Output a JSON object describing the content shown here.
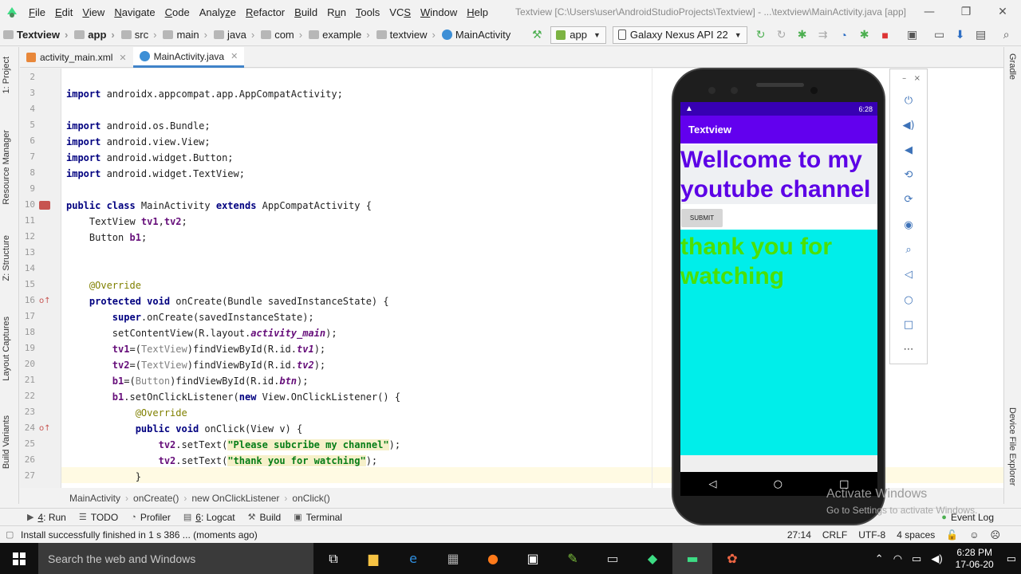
{
  "menu": {
    "items": [
      {
        "pre": "",
        "u": "F",
        "post": "ile"
      },
      {
        "pre": "",
        "u": "E",
        "post": "dit"
      },
      {
        "pre": "",
        "u": "V",
        "post": "iew"
      },
      {
        "pre": "",
        "u": "N",
        "post": "avigate"
      },
      {
        "pre": "",
        "u": "C",
        "post": "ode"
      },
      {
        "pre": "Analy",
        "u": "z",
        "post": "e"
      },
      {
        "pre": "",
        "u": "R",
        "post": "efactor"
      },
      {
        "pre": "",
        "u": "B",
        "post": "uild"
      },
      {
        "pre": "R",
        "u": "u",
        "post": "n"
      },
      {
        "pre": "",
        "u": "T",
        "post": "ools"
      },
      {
        "pre": "VC",
        "u": "S",
        "post": ""
      },
      {
        "pre": "",
        "u": "W",
        "post": "indow"
      },
      {
        "pre": "",
        "u": "H",
        "post": "elp"
      }
    ],
    "window_title": "Textview [C:\\Users\\user\\AndroidStudioProjects\\Textview] - ...\\textview\\MainActivity.java [app]"
  },
  "nav": {
    "crumbs": [
      "Textview",
      "app",
      "src",
      "main",
      "java",
      "com",
      "example",
      "textview",
      "MainActivity"
    ],
    "run_config": "app",
    "device": "Galaxy Nexus API 22"
  },
  "left_strip": [
    "1: Project",
    "Resource Manager",
    "Z: Structure",
    "Layout Captures",
    "Build Variants"
  ],
  "right_strip": [
    "Gradle",
    "Device File Explorer"
  ],
  "tabs": [
    {
      "label": "activity_main.xml",
      "icon": "xml-file-icon"
    },
    {
      "label": "MainActivity.java",
      "icon": "java-class-icon"
    }
  ],
  "code": {
    "line_numbers": [
      "2",
      "3",
      "4",
      "5",
      "6",
      "7",
      "8",
      "9",
      "10",
      "11",
      "12",
      "13",
      "14",
      "15",
      "16",
      "17",
      "18",
      "19",
      "20",
      "21",
      "22",
      "23",
      "24",
      "25",
      "26",
      "27"
    ],
    "l3_kw": "import",
    "l3_rest": " androidx.appcompat.app.AppCompatActivity;",
    "l5_kw": "import",
    "l5_rest": " android.os.Bundle;",
    "l6_kw": "import",
    "l6_rest": " android.view.View;",
    "l7_kw": "import",
    "l7_rest": " android.widget.Button;",
    "l8_kw": "import",
    "l8_rest": " android.widget.TextView;",
    "l10_kw1": "public class",
    "l10_mid": " MainActivity ",
    "l10_kw2": "extends",
    "l10_rest": " AppCompatActivity {",
    "l11_a": "    TextView ",
    "l11_b": "tv1",
    "l11_c": ",",
    "l11_d": "tv2",
    "l11_e": ";",
    "l12_a": "    Button ",
    "l12_b": "b1",
    "l12_c": ";",
    "l15": "    @Override",
    "l16_a": "    ",
    "l16_kw": "protected void",
    "l16_rest": " onCreate(Bundle savedInstanceState) {",
    "l17_a": "        ",
    "l17_kw": "super",
    "l17_rest": ".onCreate(savedInstanceState);",
    "l18_a": "        setContentView(R.layout.",
    "l18_it": "activity_main",
    "l18_rest": ");",
    "l19_a": "        ",
    "l19_f": "tv1",
    "l19_b": "=(",
    "l19_cast": "TextView",
    "l19_c": ")findViewById(R.id.",
    "l19_it": "tv1",
    "l19_d": ");",
    "l20_a": "        ",
    "l20_f": "tv2",
    "l20_b": "=(",
    "l20_cast": "TextView",
    "l20_c": ")findViewById(R.id.",
    "l20_it": "tv2",
    "l20_d": ");",
    "l21_a": "        ",
    "l21_f": "b1",
    "l21_b": "=(",
    "l21_cast": "Button",
    "l21_c": ")findViewById(R.id.",
    "l21_it": "btn",
    "l21_d": ");",
    "l22_a": "        ",
    "l22_f": "b1",
    "l22_b": ".setOnClickListener(",
    "l22_kw": "new",
    "l22_rest": " View.OnClickListener() {",
    "l23": "            @Override",
    "l24_a": "            ",
    "l24_kw": "public void",
    "l24_rest": " onClick(View v) {",
    "l25_a": "                ",
    "l25_f": "tv2",
    "l25_b": ".setText(",
    "l25_s": "\"Please subcribe my channel\"",
    "l25_c": ");",
    "l26_a": "                ",
    "l26_f": "tv2",
    "l26_b": ".setText(",
    "l26_s": "\"thank you for watching\"",
    "l26_c": ");",
    "l27": "            }"
  },
  "code_crumb": [
    "MainActivity",
    "onCreate()",
    "new OnClickListener",
    "onClick()"
  ],
  "tool_windows": {
    "run_num": "4",
    "run": ": Run",
    "todo": "TODO",
    "profiler": "Profiler",
    "logcat_num": "6",
    "logcat": ": Logcat",
    "build": "Build",
    "terminal": "Terminal",
    "event_log": "Event Log"
  },
  "status": {
    "message": "Install successfully finished in 1 s 386 ... (moments ago)",
    "position": "27:14",
    "line_sep": "CRLF",
    "encoding": "UTF-8",
    "indent": "4 spaces"
  },
  "emulator": {
    "time": "6:28",
    "app_title": "Textview",
    "tv1_text": "Wellcome to my youtube channel",
    "button_label": "SUBMIT",
    "tv2_text": "thank you for watching",
    "close": "×",
    "minimize": "–"
  },
  "watermark": {
    "title": "Activate Windows",
    "subtitle": "Go to Settings to activate Windows."
  },
  "taskbar": {
    "search_placeholder": "Search the web and Windows",
    "time": "6:28 PM",
    "date": "17-06-20"
  },
  "colors": {
    "accent": "#6200ee",
    "status_bar": "#3700b3",
    "tv1_color": "#5c00e6",
    "tv2_bg": "#00eeea",
    "tv2_color": "#4ce000"
  }
}
